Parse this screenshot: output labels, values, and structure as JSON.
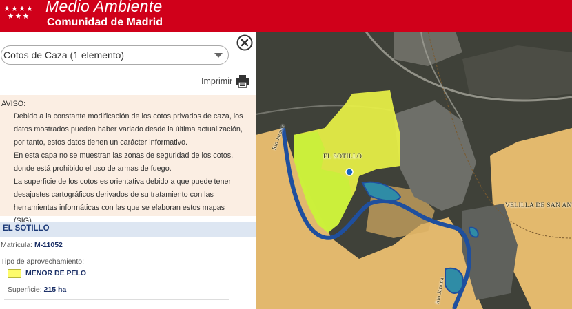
{
  "header": {
    "title": "Medio Ambiente",
    "subtitle": "Comunidad de Madrid",
    "logo_icon": "madrid-stars-icon",
    "background_color": "#d0001a"
  },
  "panel": {
    "layer_select": {
      "value": "Cotos de Caza (1 elemento)"
    },
    "close_icon": "close-icon",
    "print": {
      "label": "Imprimir",
      "icon": "printer-icon"
    },
    "notice": {
      "title": "AVISO:",
      "paragraphs": [
        "Debido a la constante modificación de los cotos privados de caza, los datos mostrados pueden haber variado desde la última actualización, por tanto, estos datos tienen un carácter informativo.",
        "En esta capa no se muestran las zonas de seguridad de los cotos, donde está prohibido el uso de armas de fuego.",
        "La superficie de los cotos es orientativa debido a que puede tener desajustes cartográficos derivados de su tratamiento con las herramientas informáticas con las que se elaboran estos mapas (SIG)."
      ]
    },
    "record": {
      "name": "EL SOTILLO",
      "matricula_label": "Matrícula:",
      "matricula_value": "M-11052",
      "tipo_label": "Tipo de aprovechamiento:",
      "tipo_value": "MENOR DE PELO",
      "tipo_color": "#fdfb6b",
      "superficie_label": "Superficie:",
      "superficie_value": "215 ha"
    }
  },
  "map": {
    "labels": {
      "coto": "EL SOTILLO",
      "town": "VELILLA DE SAN ANTONIO",
      "river_1": "Río Jarama",
      "river_2": "Río Jarama"
    },
    "coto_fill_color": "#e9f246",
    "selected_fill_color": "#c9f03a",
    "river_color": "#1f4f9e",
    "marker_color": "#1565c0"
  }
}
